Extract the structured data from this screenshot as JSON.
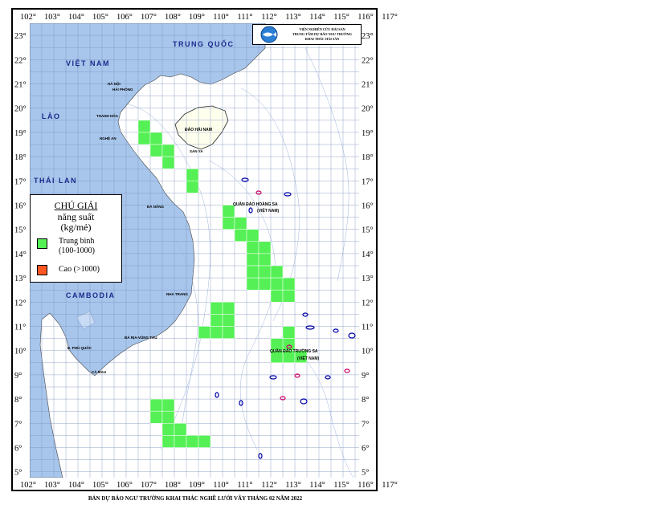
{
  "map": {
    "lon_labels": [
      "102°",
      "103°",
      "104°",
      "105°",
      "106°",
      "107°",
      "108°",
      "109°",
      "110°",
      "111°",
      "112°",
      "113°",
      "114°",
      "115°",
      "116°",
      "117°"
    ],
    "lat_labels": [
      "23°",
      "22°",
      "21°",
      "20°",
      "19°",
      "18°",
      "17°",
      "16°",
      "15°",
      "14°",
      "13°",
      "12°",
      "11°",
      "10°",
      "9°",
      "8°",
      "7°",
      "6°",
      "5°"
    ],
    "countries": {
      "trung_quoc": "TRUNG QUỐC",
      "viet_nam": "VIỆT NAM",
      "lao": "LÀO",
      "thai_lan": "THÁI LAN",
      "cambodia": "CAMBODIA"
    },
    "cities": {
      "ha_noi": "HÀ NỘI",
      "hai_phong": "HẢI PHÒNG",
      "thanh_hoa": "THANH HÓA",
      "nghe_an": "NGHỆ AN",
      "da_nang": "ĐÀ NẴNG",
      "nha_trang": "NHA TRANG",
      "ba_ria_vung_tau": "BÀ RỊA-VŨNG TÀU",
      "phu_quoc": "Đ. PHÚ QUỐC",
      "ca_mau": "CÀ MAU",
      "san_ya": "SAN YA"
    },
    "islands": {
      "hai_nam": "ĐẢO HẢI NAM",
      "hoang_sa": "QUẦN ĐẢO HOÀNG SA",
      "hoang_sa_vn": "(VIỆT NAM)",
      "truong_sa": "QUẦN ĐẢO TRƯỜNG SA",
      "truong_sa_vn": "(VIỆT NAM)"
    },
    "fishing_cells_medium": [
      [
        106.5,
        19.5
      ],
      [
        106.5,
        19.0
      ],
      [
        107.0,
        19.0
      ],
      [
        107.0,
        18.5
      ],
      [
        107.5,
        18.5
      ],
      [
        107.5,
        18.0
      ],
      [
        108.5,
        17.5
      ],
      [
        108.5,
        17.0
      ],
      [
        110.0,
        16.0
      ],
      [
        110.0,
        15.5
      ],
      [
        110.5,
        15.5
      ],
      [
        110.5,
        15.0
      ],
      [
        111.0,
        15.0
      ],
      [
        111.0,
        14.5
      ],
      [
        111.5,
        14.5
      ],
      [
        111.0,
        14.0
      ],
      [
        111.5,
        14.0
      ],
      [
        111.0,
        13.5
      ],
      [
        111.5,
        13.5
      ],
      [
        112.0,
        13.5
      ],
      [
        111.0,
        13.0
      ],
      [
        111.5,
        13.0
      ],
      [
        112.0,
        13.0
      ],
      [
        112.5,
        13.0
      ],
      [
        112.0,
        12.5
      ],
      [
        112.5,
        12.5
      ],
      [
        109.5,
        12.0
      ],
      [
        110.0,
        12.0
      ],
      [
        109.5,
        11.5
      ],
      [
        110.0,
        11.5
      ],
      [
        109.0,
        11.0
      ],
      [
        109.5,
        11.0
      ],
      [
        110.0,
        11.0
      ],
      [
        112.5,
        11.0
      ],
      [
        112.5,
        10.5
      ],
      [
        112.0,
        10.5
      ],
      [
        112.5,
        10.0
      ],
      [
        112.0,
        10.0
      ],
      [
        113.0,
        10.0
      ],
      [
        107.0,
        8.0
      ],
      [
        107.5,
        8.0
      ],
      [
        107.0,
        7.5
      ],
      [
        107.5,
        7.5
      ],
      [
        107.5,
        7.0
      ],
      [
        108.0,
        7.0
      ],
      [
        107.5,
        6.5
      ],
      [
        108.0,
        6.5
      ],
      [
        108.5,
        6.5
      ],
      [
        109.0,
        6.5
      ]
    ],
    "colors": {
      "medium": "#55f055",
      "high": "#ff5722",
      "sea": "#ffffff",
      "land": "#a8c6ec",
      "grid": "#7a8fbc",
      "label": "#1c2a8c"
    }
  },
  "legend": {
    "title": "CHÚ GIẢI",
    "subtitle1": "năng suất",
    "subtitle2": "(kg/mẻ)",
    "medium_label": "Trung bình",
    "medium_range": "(100-1000)",
    "high_label": "Cao (>1000)"
  },
  "logo": {
    "institute": "VIỆN NGHIÊN CỨU HẢI SẢN",
    "center": "TRUNG TÂM DỰ BÁO NGƯ TRƯỜNG",
    "division": "KHAI THÁC HẢI SẢN"
  },
  "caption": "BẢN DỰ BÁO NGƯ TRƯỜNG KHAI THÁC NGHỀ LƯỚI VÂY THÁNG 02 NĂM 2022"
}
